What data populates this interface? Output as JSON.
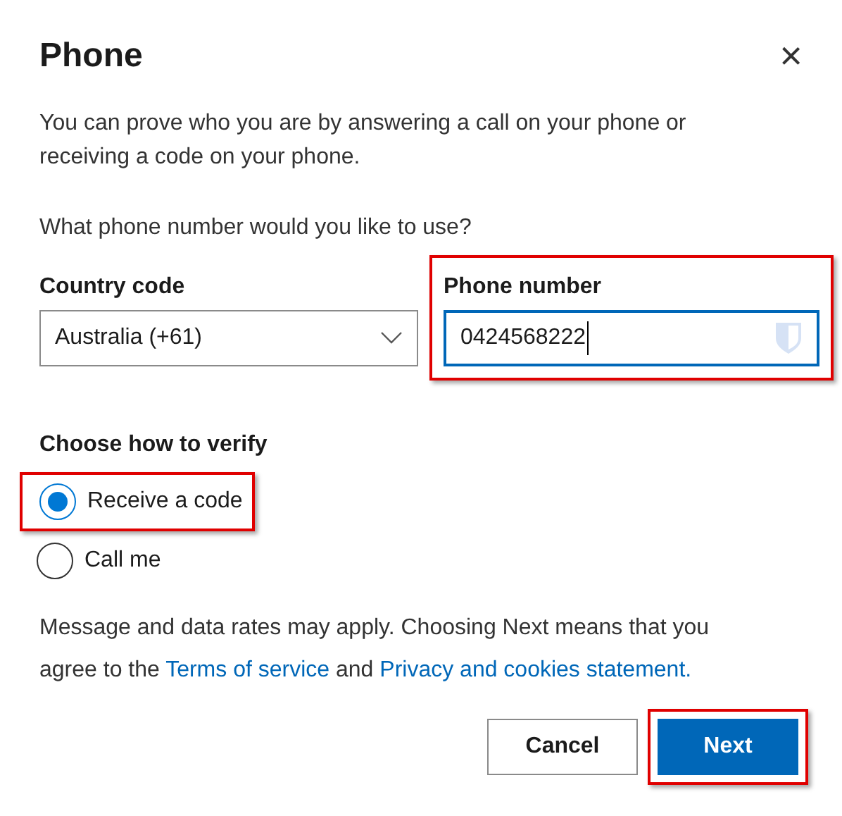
{
  "dialog": {
    "title": "Phone",
    "close": "×"
  },
  "intro": "You can prove who you are by answering a call on your phone or receiving a code on your phone.",
  "question": "What phone number would you like to use?",
  "country": {
    "label": "Country code",
    "value": "Australia (+61)",
    "highlighted": false
  },
  "phone": {
    "label": "Phone number",
    "value": "0424568222",
    "highlighted": true
  },
  "verify": {
    "label": "Choose how to verify",
    "options": [
      {
        "label": "Receive a code",
        "selected": true,
        "highlighted": true
      },
      {
        "label": "Call me",
        "selected": false,
        "highlighted": false
      }
    ]
  },
  "consent": {
    "before": "Message and data rates may apply. Choosing Next means that you agree to the",
    "link_1": "Terms of service",
    "between": "and",
    "link_2": "Privacy and cookies statement."
  },
  "buttons": [
    {
      "label": "Cancel",
      "kind": "secondary",
      "highlighted": false
    },
    {
      "label": "Next",
      "kind": "primary",
      "highlighted": true
    }
  ]
}
